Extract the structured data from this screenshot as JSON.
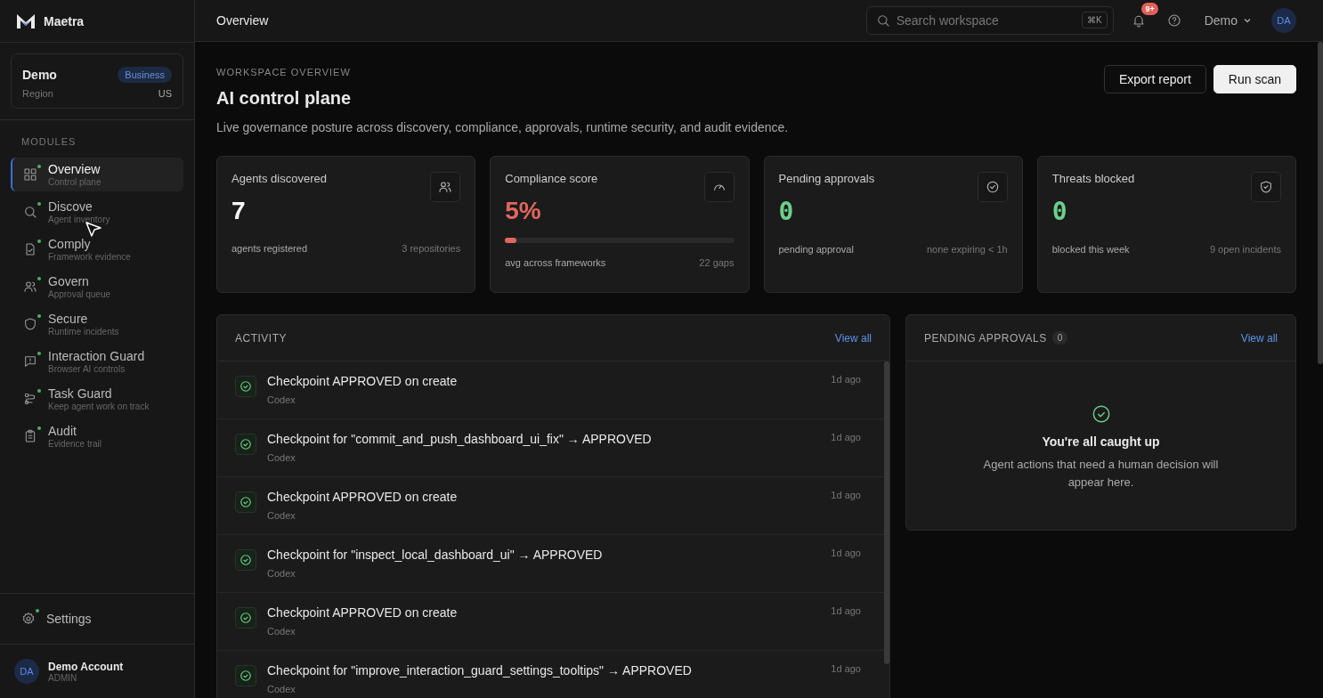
{
  "brand": {
    "name": "Maetra"
  },
  "workspace": {
    "name": "Demo",
    "plan": "Business",
    "region_label": "Region",
    "region": "US"
  },
  "sidebar": {
    "section_label": "MODULES",
    "items": [
      {
        "label": "Overview",
        "sublabel": "Control plane",
        "selected": true
      },
      {
        "label": "Discove",
        "sublabel": "Agent inventory",
        "selected": false
      },
      {
        "label": "Comply",
        "sublabel": "Framework evidence",
        "selected": false
      },
      {
        "label": "Govern",
        "sublabel": "Approval queue",
        "selected": false
      },
      {
        "label": "Secure",
        "sublabel": "Runtime incidents",
        "selected": false
      },
      {
        "label": "Interaction Guard",
        "sublabel": "Browser AI controls",
        "selected": false
      },
      {
        "label": "Task Guard",
        "sublabel": "Keep agent work on track",
        "selected": false
      },
      {
        "label": "Audit",
        "sublabel": "Evidence trail",
        "selected": false
      }
    ],
    "settings": "Settings",
    "account": {
      "initials": "DA",
      "name": "Demo Account",
      "role": "ADMIN"
    }
  },
  "topbar": {
    "title": "Overview",
    "search": {
      "placeholder": "Search workspace",
      "shortcut": "⌘K"
    },
    "notifications_badge": "9+",
    "workspace_menu": "Demo",
    "avatar": "DA"
  },
  "header": {
    "eyebrow": "WORKSPACE OVERVIEW",
    "title": "AI control plane",
    "description": "Live governance posture across discovery, compliance, approvals, runtime security, and audit evidence.",
    "buttons": [
      {
        "label": "Export report",
        "kind": "secondary"
      },
      {
        "label": "Run scan",
        "kind": "primary"
      }
    ]
  },
  "stats": [
    {
      "title": "Agents discovered",
      "value": "7",
      "color": "#fafafa",
      "caption": "agents registered",
      "detail": "3 repositories"
    },
    {
      "title": "Compliance score",
      "value": "5%",
      "color": "#e0665e",
      "level": 0.05,
      "caption": "avg across frameworks",
      "detail": "22 gaps"
    },
    {
      "title": "Pending approvals",
      "value": "0",
      "color": "#6ccf8a",
      "caption": "pending approval",
      "detail": "none expiring < 1h"
    },
    {
      "title": "Threats blocked",
      "value": "0",
      "color": "#6ccf8a",
      "caption": "blocked this week",
      "detail": "9 open incidents"
    }
  ],
  "activity": {
    "title": "ACTIVITY",
    "link": "View all",
    "rows": [
      {
        "text": "Checkpoint APPROVED on create",
        "source": "Codex",
        "time": "1d ago"
      },
      {
        "text": "Checkpoint for \"commit_and_push_dashboard_ui_fix\" → APPROVED",
        "source": "Codex",
        "time": "1d ago"
      },
      {
        "text": "Checkpoint APPROVED on create",
        "source": "Codex",
        "time": "1d ago"
      },
      {
        "text": "Checkpoint for \"inspect_local_dashboard_ui\" → APPROVED",
        "source": "Codex",
        "time": "1d ago"
      },
      {
        "text": "Checkpoint APPROVED on create",
        "source": "Codex",
        "time": "1d ago"
      },
      {
        "text": "Checkpoint for \"improve_interaction_guard_settings_tooltips\" → APPROVED",
        "source": "Codex",
        "time": "1d ago"
      }
    ]
  },
  "approvals": {
    "title": "PENDING APPROVALS",
    "count": "0",
    "link": "View all",
    "empty_title": "You're all caught up",
    "empty_text": "Agent actions that need a human decision will appear here."
  }
}
